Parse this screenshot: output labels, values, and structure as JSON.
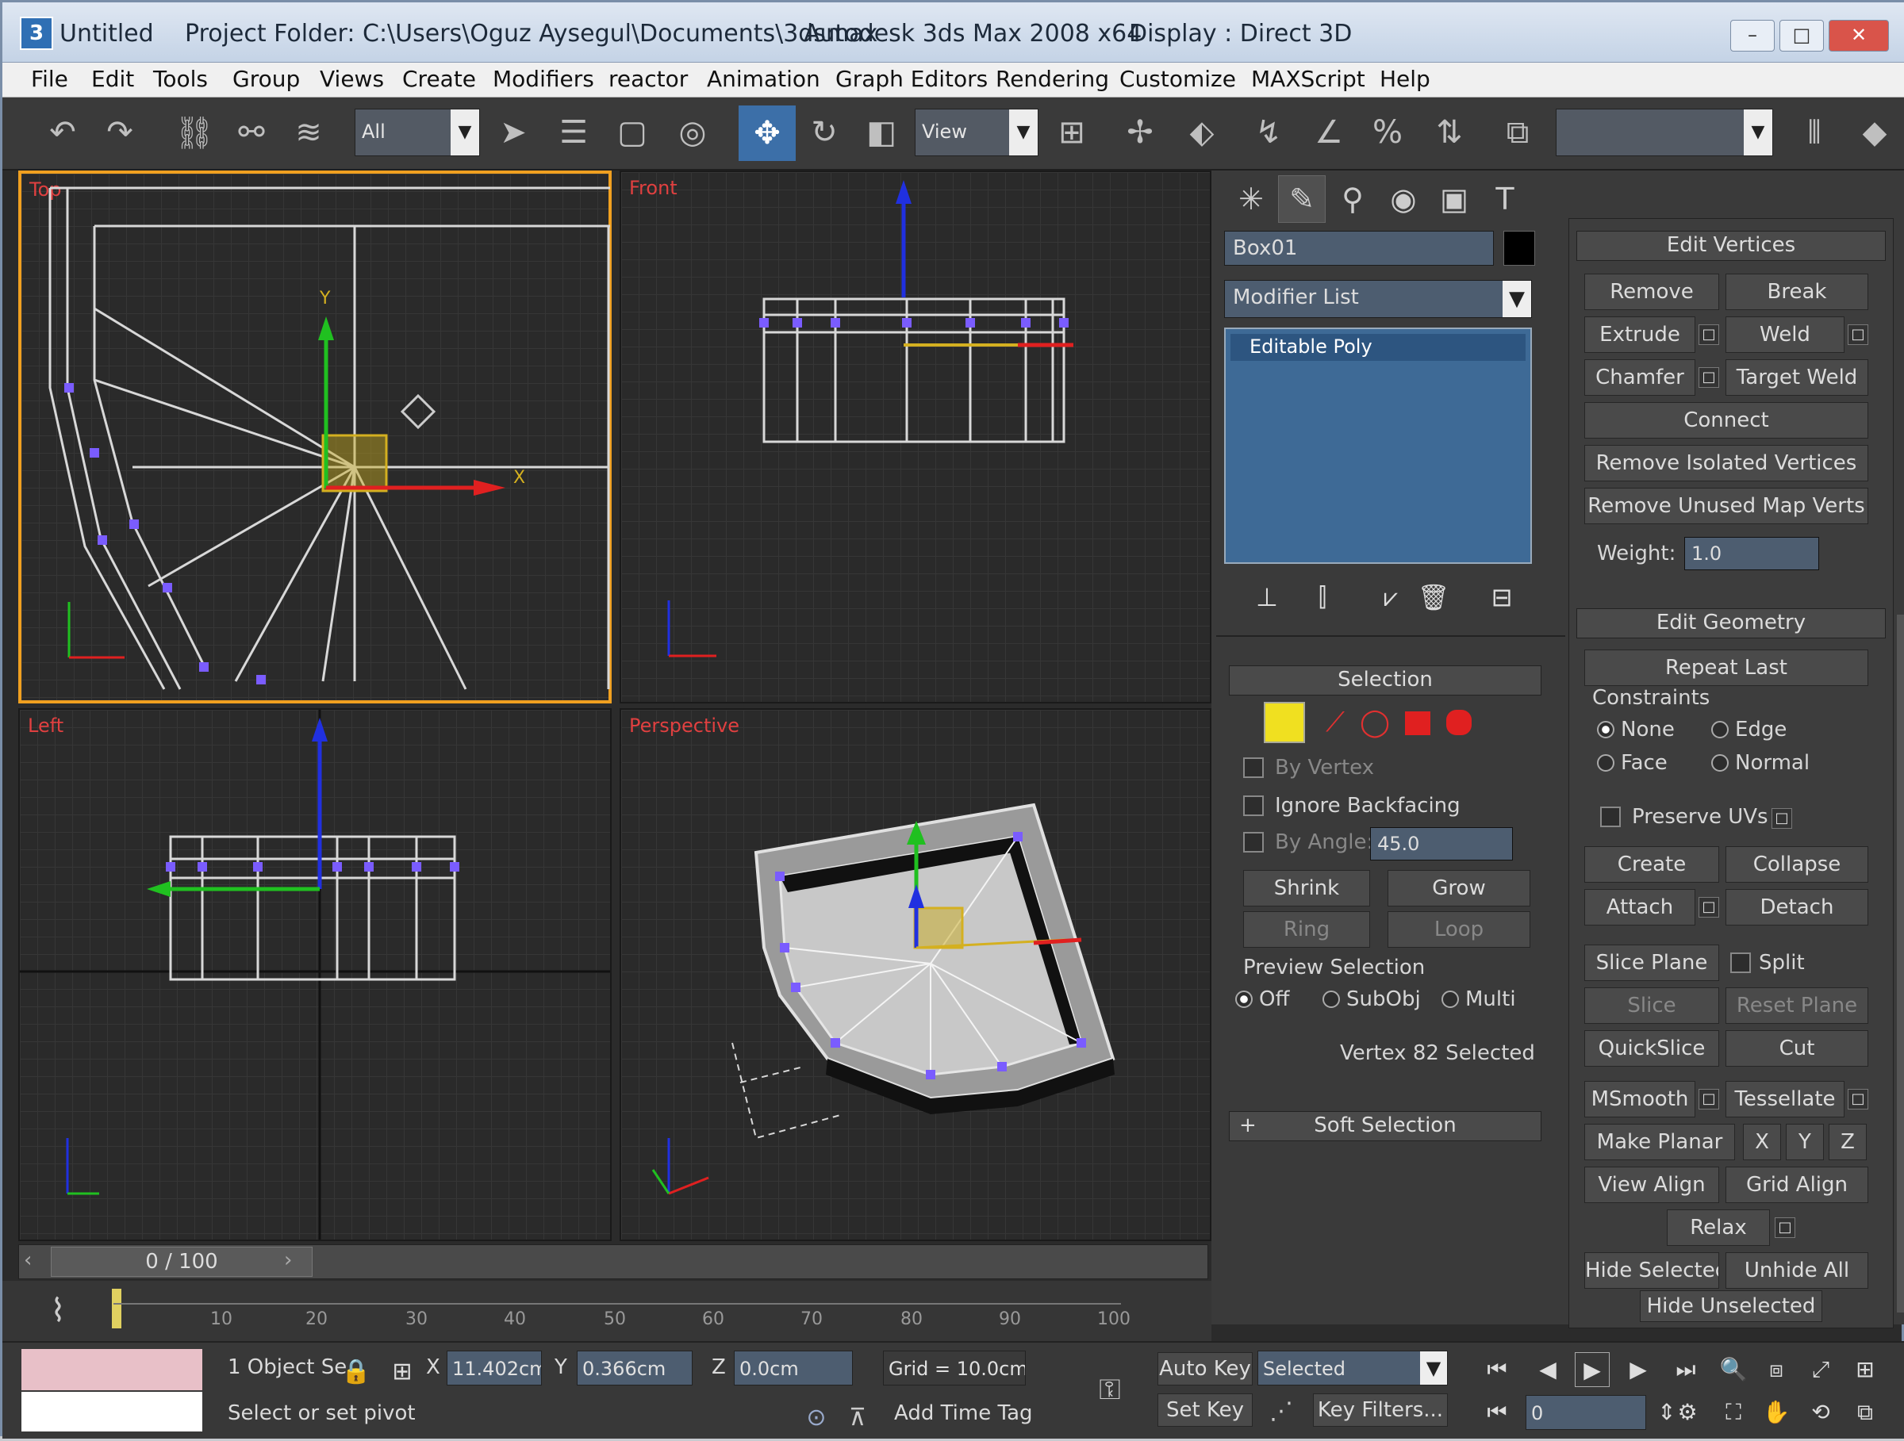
{
  "titlebar": {
    "app_icon": "3ds-max-logo",
    "doc_name": "Untitled",
    "project_folder": "Project Folder: C:\\Users\\Oguz Aysegul\\Documents\\3dsmax",
    "app_name": "Autodesk 3ds Max 2008 x64",
    "display": "Display : Direct 3D",
    "minimize_icon": "minimize-icon",
    "maximize_icon": "maximize-icon",
    "close_icon": "close-icon"
  },
  "menu": [
    "File",
    "Edit",
    "Tools",
    "Group",
    "Views",
    "Create",
    "Modifiers",
    "reactor",
    "Animation",
    "Graph Editors",
    "Rendering",
    "Customize",
    "MAXScript",
    "Help"
  ],
  "toolbar": {
    "selection_filter": "All",
    "ref_coord": "View",
    "named_sel_set": "",
    "icons": [
      "undo-icon",
      "redo-icon",
      "select-link-icon",
      "unlink-icon",
      "bind-spacewarp-icon",
      "select-object-icon",
      "select-by-name-icon",
      "rect-region-icon",
      "window-crossing-icon",
      "move-icon",
      "rotate-icon",
      "scale-icon",
      "pivot-icon",
      "manipulate-icon",
      "keyboard-shortcut-icon",
      "snap-icon",
      "angle-snap-icon",
      "percent-snap-icon",
      "spinner-snap-icon",
      "edit-named-sets-icon",
      "mirror-icon",
      "align-icon"
    ]
  },
  "viewports": {
    "top": "Top",
    "front": "Front",
    "left": "Left",
    "perspective": "Perspective"
  },
  "command_panel": {
    "tabs": [
      "create-tab-icon",
      "modify-tab-icon",
      "hierarchy-tab-icon",
      "motion-tab-icon",
      "display-tab-icon",
      "utilities-tab-icon"
    ],
    "object_name": "Box01",
    "object_color": "#000000",
    "modifier_list": "Modifier List",
    "stack_item": "Editable Poly",
    "stack_buttons": [
      "pin-stack-icon",
      "show-end-result-icon",
      "make-unique-icon",
      "remove-modifier-icon",
      "configure-modifier-sets-icon"
    ],
    "selection": {
      "header": "Selection",
      "subobjects": [
        "vertex-icon",
        "edge-icon",
        "border-icon",
        "polygon-icon",
        "element-icon"
      ],
      "by_vertex": "By Vertex",
      "ignore_backfacing": "Ignore Backfacing",
      "by_angle": "By Angle:",
      "angle_value": "45.0",
      "shrink": "Shrink",
      "grow": "Grow",
      "ring": "Ring",
      "loop": "Loop",
      "preview_selection": "Preview Selection",
      "off": "Off",
      "subobj": "SubObj",
      "multi": "Multi",
      "status": "Vertex 82 Selected"
    },
    "soft_selection": "Soft Selection",
    "edit_vertices": {
      "header": "Edit Vertices",
      "remove": "Remove",
      "break": "Break",
      "extrude": "Extrude",
      "weld": "Weld",
      "chamfer": "Chamfer",
      "target_weld": "Target Weld",
      "connect": "Connect",
      "remove_isolated": "Remove Isolated Vertices",
      "remove_unused": "Remove Unused Map Verts",
      "weight_label": "Weight:",
      "weight_value": "1.0"
    },
    "edit_geometry": {
      "header": "Edit Geometry",
      "repeat_last": "Repeat Last",
      "constraints": "Constraints",
      "none": "None",
      "edge": "Edge",
      "face": "Face",
      "normal": "Normal",
      "preserve_uvs": "Preserve UVs",
      "create": "Create",
      "collapse": "Collapse",
      "attach": "Attach",
      "detach": "Detach",
      "slice_plane": "Slice Plane",
      "split": "Split",
      "slice": "Slice",
      "reset_plane": "Reset Plane",
      "quickslice": "QuickSlice",
      "cut": "Cut",
      "msmooth": "MSmooth",
      "tessellate": "Tessellate",
      "make_planar": "Make Planar",
      "x": "X",
      "y": "Y",
      "z": "Z",
      "view_align": "View Align",
      "grid_align": "Grid Align",
      "relax": "Relax",
      "hide_selected": "Hide Selected",
      "unhide_all": "Unhide All",
      "hide_unselected": "Hide Unselected"
    }
  },
  "timeline": {
    "frame": "0 / 100",
    "ticks": [
      "10",
      "20",
      "30",
      "40",
      "50",
      "60",
      "70",
      "80",
      "90",
      "100"
    ]
  },
  "status": {
    "selected": "1 Object Se",
    "x_label": "X",
    "x": "11.402cm",
    "y_label": "Y",
    "y": "0.366cm",
    "z_label": "Z",
    "z": "0.0cm",
    "grid": "Grid = 10.0cm",
    "prompt": "Select or set pivot",
    "add_time_tag": "Add Time Tag",
    "auto_key": "Auto Key",
    "selected_dropdown": "Selected",
    "set_key": "Set Key",
    "key_filters": "Key Filters...",
    "frame_value": "0"
  },
  "colors": {
    "selection_orange": "#f0a020",
    "axis_red": "#e02020",
    "axis_green": "#20c020",
    "axis_blue": "#2030e0",
    "vertex_purple": "#7a5cff"
  }
}
